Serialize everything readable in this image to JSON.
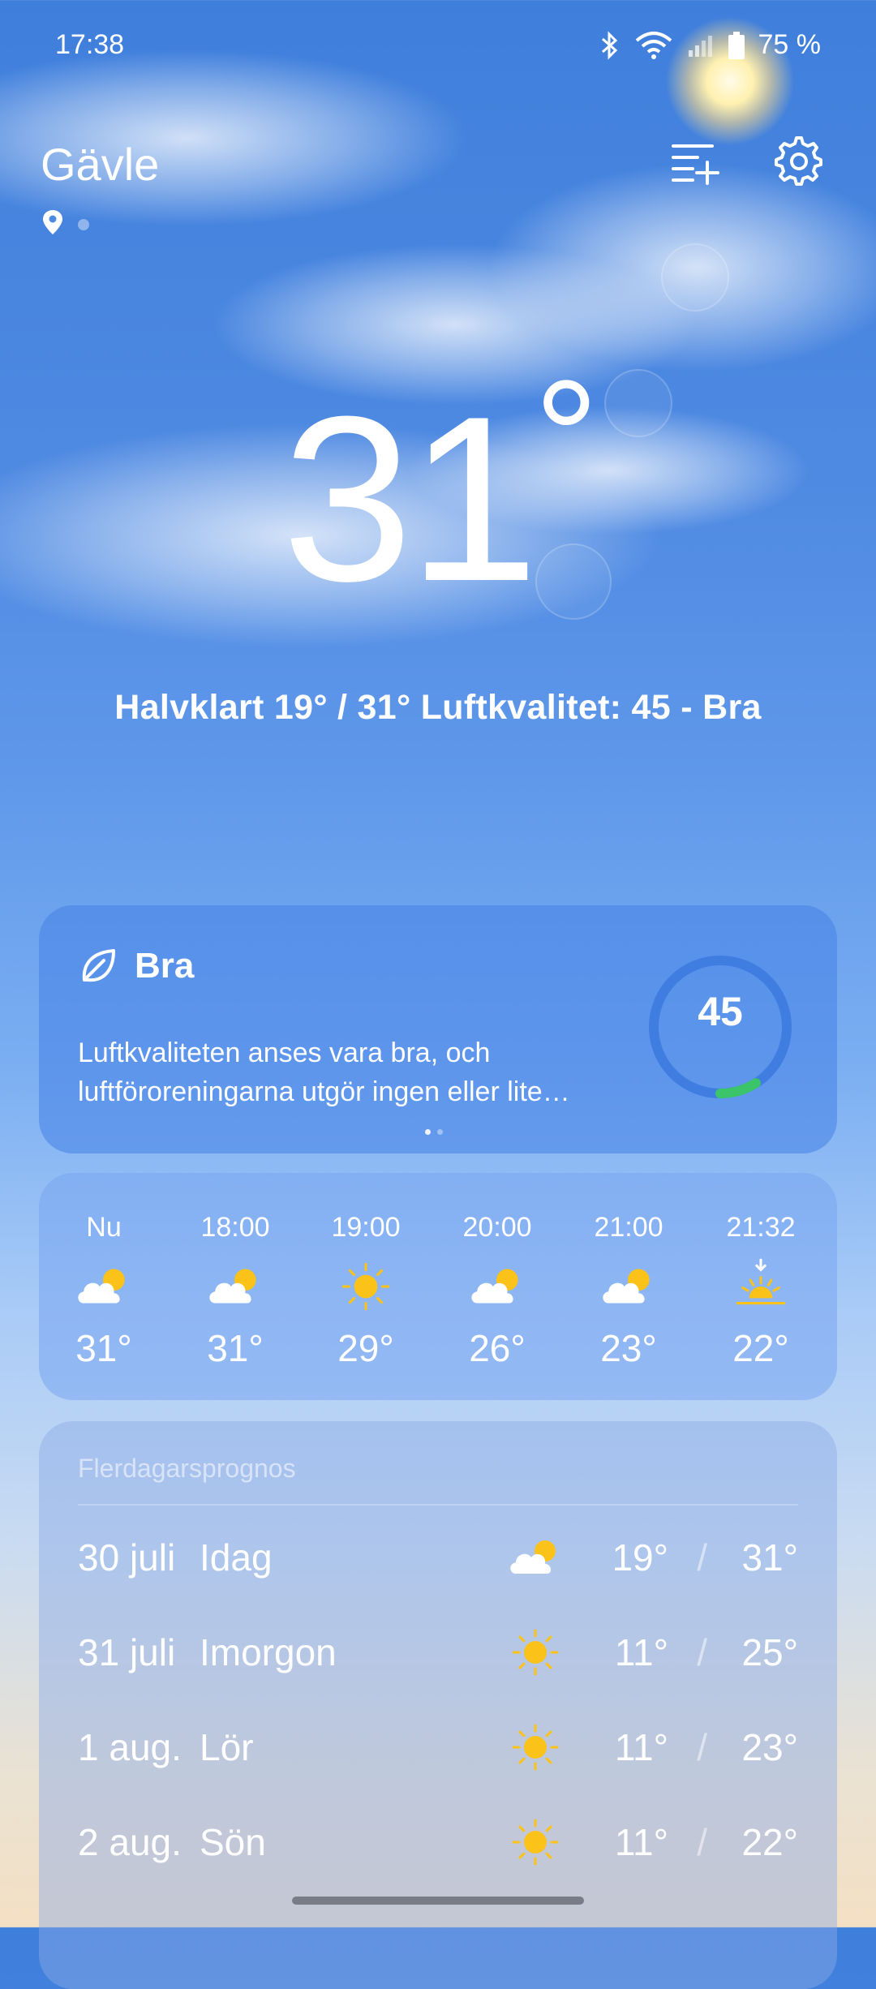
{
  "status_bar": {
    "time": "17:38",
    "battery": "75 %"
  },
  "header": {
    "city": "Gävle"
  },
  "current": {
    "temperature": "31",
    "degree": "°",
    "summary": "Halvklart  19° / 31°  Luftkvalitet: 45 - Bra"
  },
  "air_quality": {
    "label": "Bra",
    "description_line1": "Luftkvaliteten anses vara bra, och",
    "description_line2": "luftföroreningarna utgör ingen eller lite…",
    "value": "45",
    "gauge_fraction": 0.09,
    "page_count": 2,
    "active_page": 1
  },
  "hourly": [
    {
      "time": "Nu",
      "icon": "partly-cloudy-icon",
      "temp": "31°"
    },
    {
      "time": "18:00",
      "icon": "partly-cloudy-icon",
      "temp": "31°"
    },
    {
      "time": "19:00",
      "icon": "sun-icon",
      "temp": "29°"
    },
    {
      "time": "20:00",
      "icon": "partly-cloudy-icon",
      "temp": "26°"
    },
    {
      "time": "21:00",
      "icon": "partly-cloudy-icon",
      "temp": "23°"
    },
    {
      "time": "21:32",
      "icon": "sunset-icon",
      "temp": "22°"
    }
  ],
  "daily": {
    "title": "Flerdagarsprognos",
    "days": [
      {
        "date": "30 juli",
        "day": "Idag",
        "icon": "partly-cloudy-icon",
        "low": "19°",
        "high": "31°"
      },
      {
        "date": "31 juli",
        "day": "Imorgon",
        "icon": "sun-icon",
        "low": "11°",
        "high": "25°"
      },
      {
        "date": "1 aug.",
        "day": "Lör",
        "icon": "sun-icon",
        "low": "11°",
        "high": "23°"
      },
      {
        "date": "2 aug.",
        "day": "Sön",
        "icon": "sun-icon",
        "low": "11°",
        "high": "22°"
      }
    ]
  },
  "colors": {
    "sun": "#fbc21a",
    "aq_good": "#3cc46a",
    "aq_ring": "#3f7de0"
  }
}
